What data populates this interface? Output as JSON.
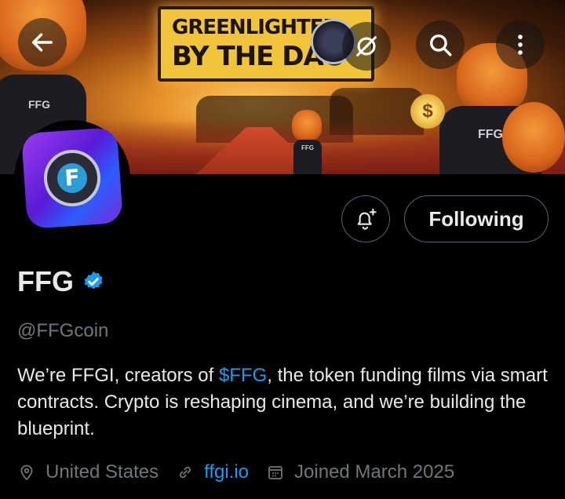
{
  "banner": {
    "sign_line1": "GREENLIGHTED",
    "sign_line2": "BY THE DAO",
    "hoodie_left": "FFG",
    "hoodie_right": "FFG",
    "hoodie_center": "FFG",
    "coin_symbol": "$"
  },
  "topbar": {
    "back_icon": "arrow-left-icon",
    "grok_icon": "grok-icon",
    "search_icon": "search-icon",
    "more_icon": "more-vertical-icon"
  },
  "avatar": {
    "letter": "F"
  },
  "actions": {
    "notify_icon": "bell-plus-icon",
    "follow_label": "Following"
  },
  "profile": {
    "name": "FFG",
    "handle": "@FFGcoin",
    "bio_before": "We’re FFGI, creators of ",
    "bio_tag": "$FFG",
    "bio_after": ", the token funding films via smart contracts. Crypto is reshaping cinema, and we’re building the blueprint.",
    "location": "United States",
    "website": "ffgi.io",
    "joined": "Joined March 2025"
  },
  "colors": {
    "accent": "#1d9bf0",
    "muted": "#71767b",
    "text": "#e7e9ea",
    "border": "#536471"
  }
}
